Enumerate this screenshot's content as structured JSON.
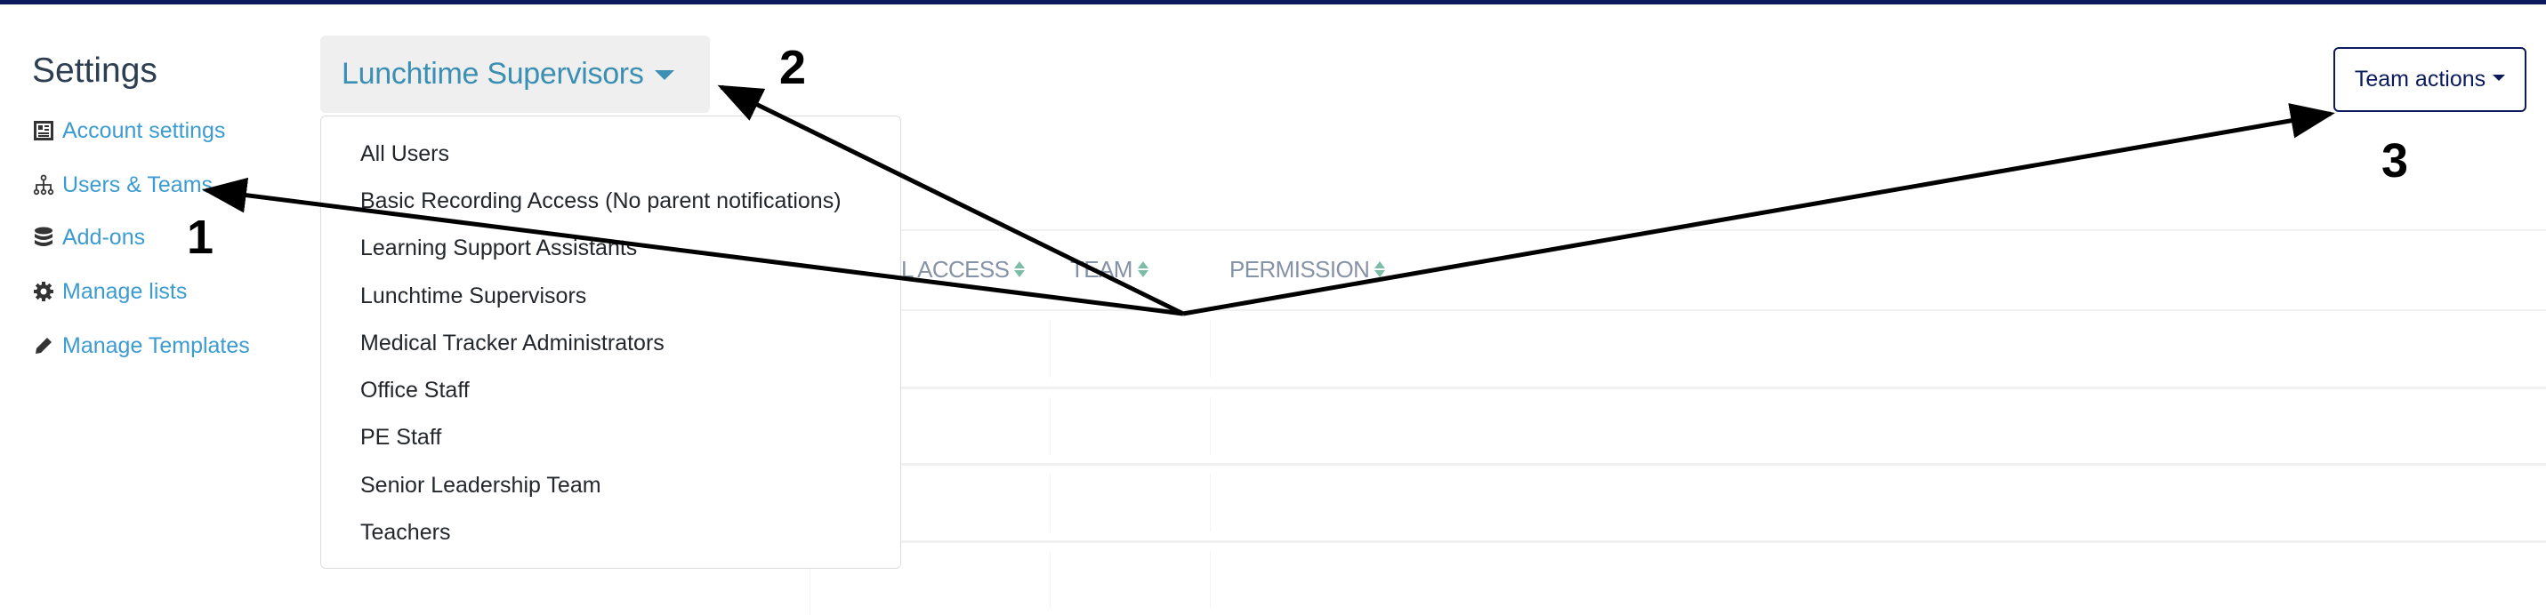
{
  "colors": {
    "topbar": "#0a1a5c",
    "link": "#3c9bd0",
    "selector_text": "#3a8fb2",
    "header_text": "#8693a7",
    "sort_icon": "#7dbca6"
  },
  "sidebar": {
    "title": "Settings",
    "items": [
      {
        "label": "Account settings",
        "icon": "newspaper-icon"
      },
      {
        "label": "Users & Teams",
        "icon": "sitemap-icon"
      },
      {
        "label": "Add-ons",
        "icon": "database-icon"
      },
      {
        "label": "Manage lists",
        "icon": "gear-icon"
      },
      {
        "label": "Manage Templates",
        "icon": "pencil-icon"
      }
    ]
  },
  "team_selector": {
    "selected": "Lunchtime Supervisors",
    "options": [
      "All Users",
      "Basic Recording Access (No parent notifications)",
      "Learning Support Assistants",
      "Lunchtime Supervisors",
      "Medical Tracker Administrators",
      "Office Staff",
      "PE Staff",
      "Senior Leadership Team",
      "Teachers"
    ]
  },
  "table": {
    "headers": [
      {
        "label": "L ACCESS",
        "sortable": true
      },
      {
        "label": "TEAM",
        "sortable": true
      },
      {
        "label": "PERMISSION",
        "sortable": true
      }
    ]
  },
  "team_actions": {
    "label": "Team actions"
  },
  "annotations": {
    "labels": [
      "1",
      "2",
      "3"
    ]
  }
}
